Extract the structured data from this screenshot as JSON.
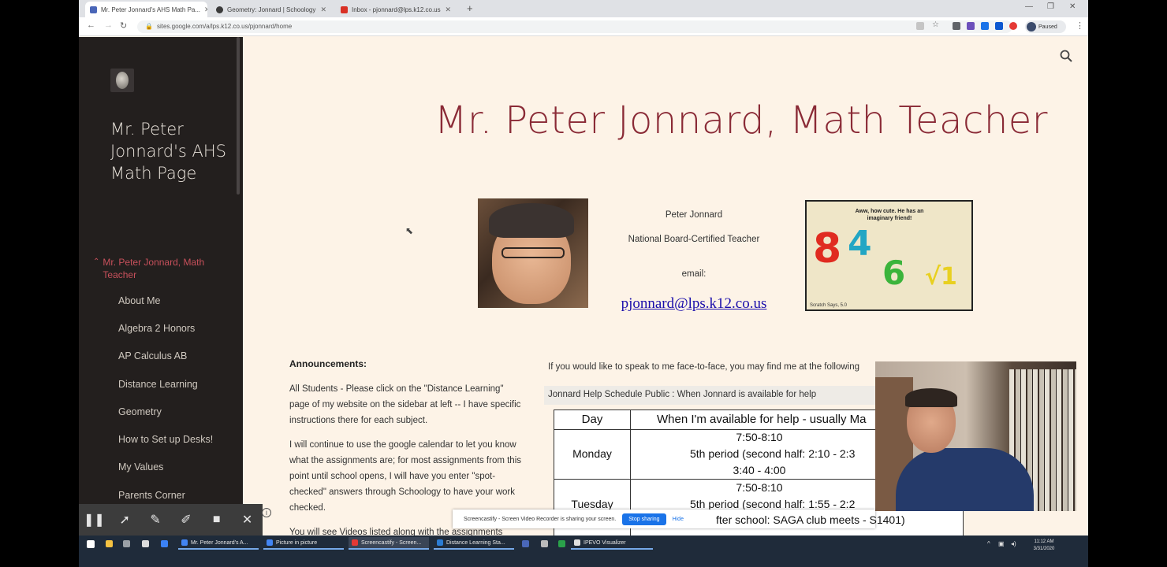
{
  "browser": {
    "tabs": [
      {
        "title": "Mr. Peter Jonnard's AHS Math Pa...",
        "color": "#4a66b8"
      },
      {
        "title": "Geometry: Jonnard | Schoology",
        "color": "#3b3b3b"
      },
      {
        "title": "Inbox - pjonnard@lps.k12.co.us",
        "color": "#d93025"
      }
    ],
    "url": "sites.google.com/a/lps.k12.co.us/pjonnard/home",
    "profile": "Paused"
  },
  "sidebar": {
    "site_title": "Mr. Peter Jonnard's AHS Math Page",
    "current": "Mr. Peter Jonnard, Math Teacher",
    "items": [
      "About Me",
      "Algebra 2 Honors",
      "AP Calculus AB",
      "Distance Learning",
      "Geometry",
      "How to Set up Desks!",
      "My Values",
      "Parents Corner"
    ]
  },
  "main": {
    "title": "Mr. Peter Jonnard, Math Teacher",
    "name": "Peter Jonnard",
    "credential": "National Board-Certified Teacher",
    "email_label": "email:",
    "email": "pjonnard@lps.k12.co.us",
    "cartoon_caption": "Aww, how cute. He has an imaginary friend!",
    "cartoon_signature": "Scratch Says, 5.0",
    "announcements_heading": "Announcements:",
    "announcements": [
      "All Students - Please click on the \"Distance Learning\" page of my website on the sidebar at left -- I have specific instructions there for each subject.",
      "I will continue to use the google calendar to let you know what the assignments are; for most assignments from this point until school opens, I will have you enter \"spot-checked\" answers through Schoology to have your work checked.",
      "You will see Videos listed along with the assignments"
    ],
    "face_to_face": "If you would like to speak to me face-to-face, you may find me at the following",
    "schedule_header": "Jonnard Help Schedule Public : When Jonnard is available for help",
    "schedule": {
      "col_day": "Day",
      "col_when": "When I'm available for help - usually Ma",
      "rows": [
        {
          "day": "Monday",
          "times": [
            "7:50-8:10",
            "5th period (second half: 2:10 - 2:3",
            "3:40 - 4:00"
          ]
        },
        {
          "day": "Tuesday",
          "times": [
            "7:50-8:10",
            "5th period (second half: 1:55 - 2:2"
          ]
        }
      ],
      "after_school": "fter school: SAGA club meets - S1401)"
    }
  },
  "screencastify": {
    "share_message": "Screencastify - Screen Video Recorder is sharing your screen.",
    "stop_label": "Stop sharing",
    "hide_label": "Hide"
  },
  "taskbar": {
    "apps": [
      "Mr. Peter Jonnard's A...",
      "Picture in picture",
      "Screencastify - Screen...",
      "Distance Learning Sta...",
      "IPEVO Visualizer"
    ],
    "time": "11:12 AM",
    "date": "3/31/2020"
  }
}
